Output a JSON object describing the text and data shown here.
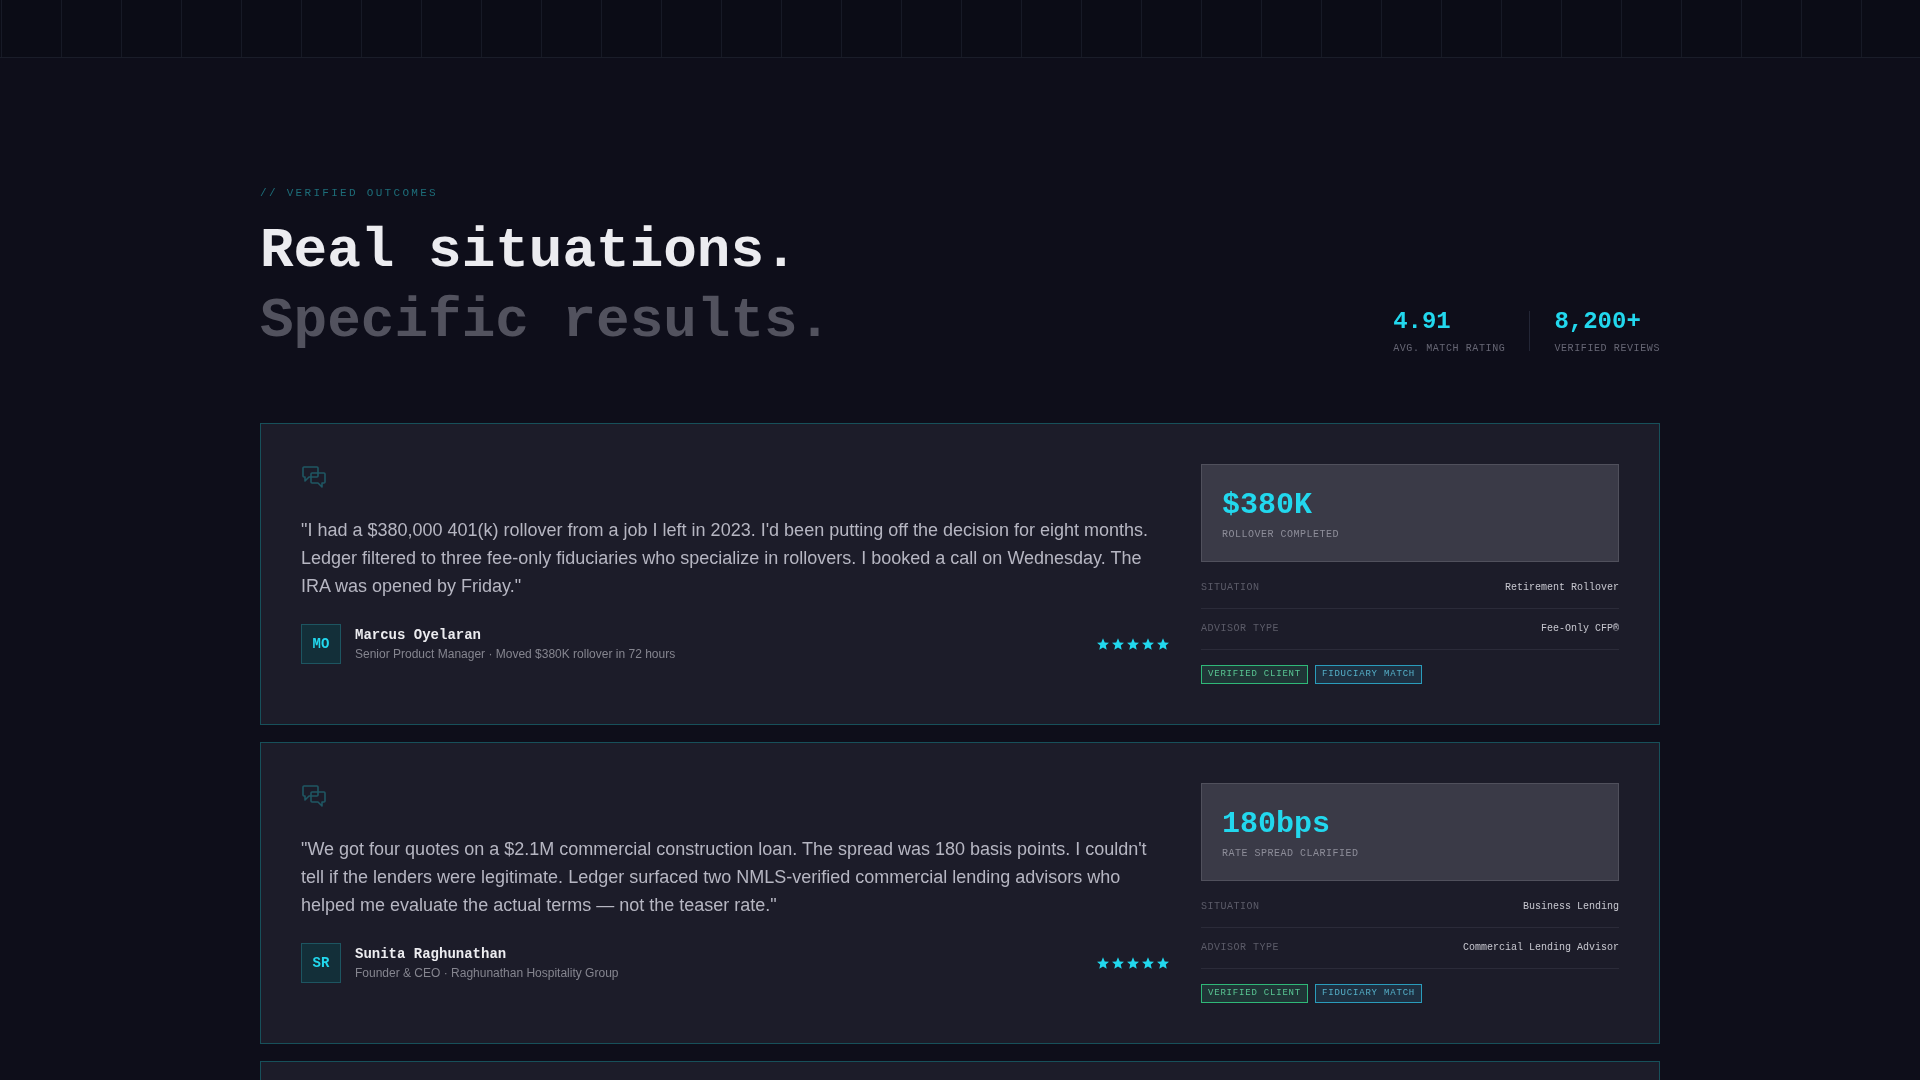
{
  "eyebrow": "// VERIFIED OUTCOMES",
  "headline": {
    "title": "Real situations.",
    "subtitle": "Specific results."
  },
  "stats": [
    {
      "value": "4.91",
      "label": "AVG. MATCH RATING"
    },
    {
      "value": "8,200+",
      "label": "VERIFIED REVIEWS"
    }
  ],
  "testimonials": [
    {
      "quote": "\"I had a $380,000 401(k) rollover from a job I left in 2023. I'd been putting off the decision for eight months. Ledger filtered to three fee-only fiduciaries who specialize in rollovers. I booked a call on Wednesday. The IRA was opened by Friday.\"",
      "author": {
        "initials": "MO",
        "name": "Marcus Oyelaran",
        "detail": "Senior Product Manager · Moved $380K rollover in 72 hours"
      },
      "stars": 5,
      "metric": {
        "value": "$380K",
        "label": "ROLLOVER COMPLETED"
      },
      "details": [
        {
          "label": "SITUATION",
          "value": "Retirement Rollover"
        },
        {
          "label": "ADVISOR TYPE",
          "value": "Fee-Only CFP®"
        }
      ],
      "tags": [
        {
          "label": "VERIFIED CLIENT",
          "color": "#2fb878"
        },
        {
          "label": "FIDUCIARY MATCH",
          "color": "#2a9cbc"
        }
      ]
    },
    {
      "quote": "\"We got four quotes on a $2.1M commercial construction loan. The spread was 180 basis points. I couldn't tell if the lenders were legitimate. Ledger surfaced two NMLS-verified commercial lending advisors who helped me evaluate the actual terms — not the teaser rate.\"",
      "author": {
        "initials": "SR",
        "name": "Sunita Raghunathan",
        "detail": "Founder & CEO · Raghunathan Hospitality Group"
      },
      "stars": 5,
      "metric": {
        "value": "180bps",
        "label": "RATE SPREAD CLARIFIED"
      },
      "details": [
        {
          "label": "SITUATION",
          "value": "Business Lending"
        },
        {
          "label": "ADVISOR TYPE",
          "value": "Commercial Lending Advisor"
        }
      ],
      "tags": [
        {
          "label": "VERIFIED CLIENT",
          "color": "#2fb878"
        },
        {
          "label": "FIDUCIARY MATCH",
          "color": "#2a9cbc"
        }
      ]
    }
  ]
}
